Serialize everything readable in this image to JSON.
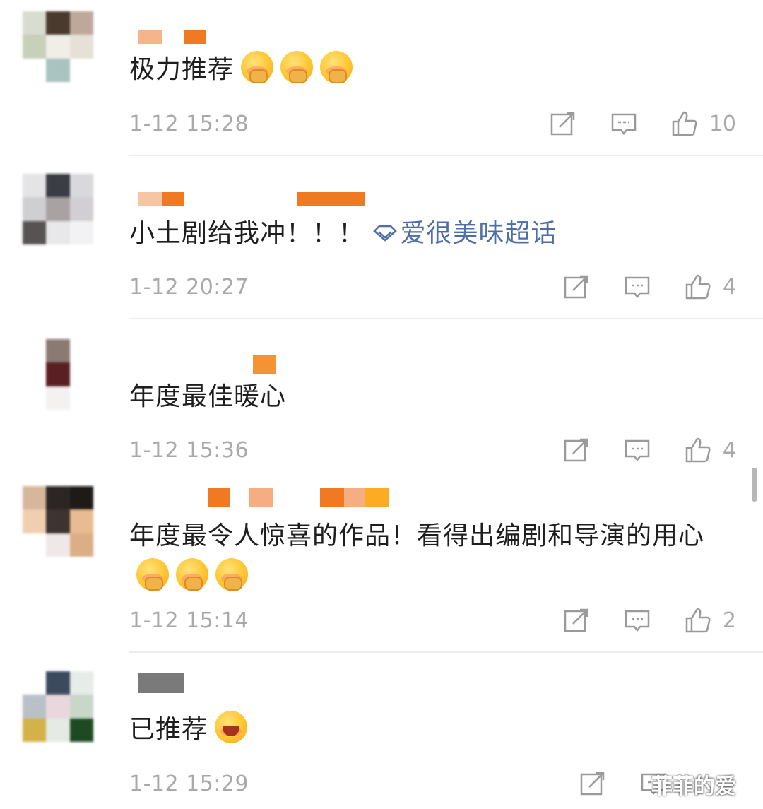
{
  "comments": [
    {
      "text": "极力推荐",
      "emojis": 3,
      "emoji_style": "blush",
      "time": "1-12 15:28",
      "likes": "10",
      "topic": ""
    },
    {
      "text": "小土剧给我冲！！！",
      "emojis": 0,
      "time": "1-12 20:27",
      "likes": "4",
      "topic": "爱很美味超话"
    },
    {
      "text": "年度最佳暖心",
      "emojis": 0,
      "time": "1-12 15:36",
      "likes": "4",
      "topic": ""
    },
    {
      "text": "年度最令人惊喜的作品！看得出编剧和导演的用心",
      "emojis": 3,
      "emoji_style": "blush",
      "time": "1-12 15:14",
      "likes": "2",
      "topic": ""
    },
    {
      "text": "已推荐",
      "emojis": 1,
      "emoji_style": "laugh",
      "time": "1-12 15:29",
      "likes": "",
      "topic": ""
    }
  ],
  "icons": {
    "share": "share-icon",
    "reply": "comment-icon",
    "like": "thumbs-up-icon",
    "topic": "diamond-icon"
  },
  "colors": {
    "topic": "#4e6ea8",
    "meta": "#a9a9a9",
    "username_accent": "#f07a22"
  },
  "watermark": "菲菲的爱"
}
